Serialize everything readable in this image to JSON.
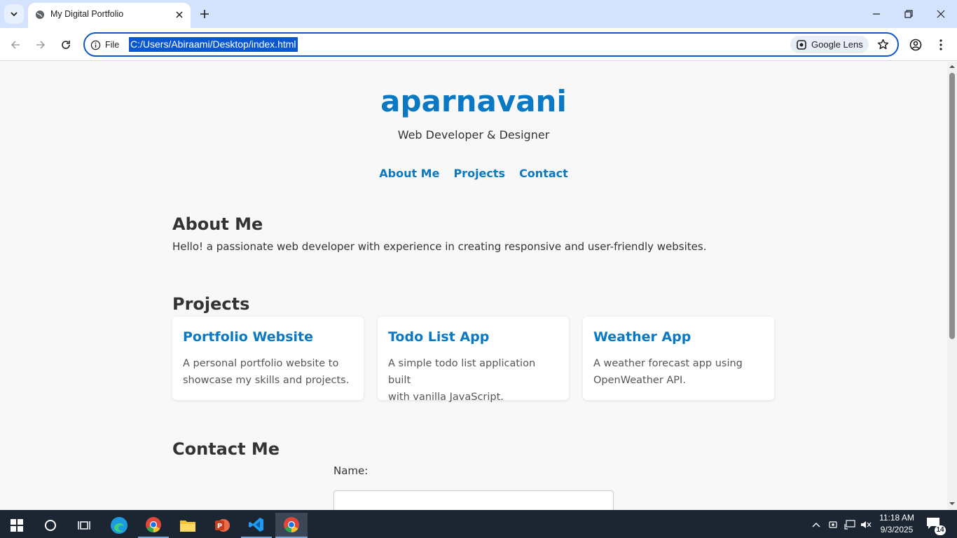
{
  "browser": {
    "tab_title": "My Digital Portfolio",
    "site_info_label": "File",
    "url": "C:/Users/Abiraami/Desktop/index.html",
    "lens_label": "Google Lens"
  },
  "page": {
    "title": "aparnavani",
    "subtitle": "Web Developer & Designer",
    "nav": [
      "About Me",
      "Projects",
      "Contact"
    ],
    "about": {
      "heading": "About Me",
      "text": "Hello! a passionate web developer with experience in creating responsive and user-friendly websites."
    },
    "projects": {
      "heading": "Projects",
      "items": [
        {
          "title": "Portfolio Website",
          "line1": "A personal portfolio website to",
          "line2": "showcase my skills and projects."
        },
        {
          "title": "Todo List App",
          "line1": "A simple todo list application built",
          "line2": "with vanilla JavaScript."
        },
        {
          "title": "Weather App",
          "line1": "A weather forecast app using",
          "line2": "OpenWeather API."
        }
      ]
    },
    "contact": {
      "heading": "Contact Me",
      "name_label": "Name:"
    }
  },
  "taskbar": {
    "time": "11:18 AM",
    "date": "9/3/2025",
    "notification_count": "14"
  },
  "colors": {
    "accent": "#0a78c3",
    "chrome_tabstrip": "#d3e3fd",
    "taskbar": "#1c2633"
  }
}
